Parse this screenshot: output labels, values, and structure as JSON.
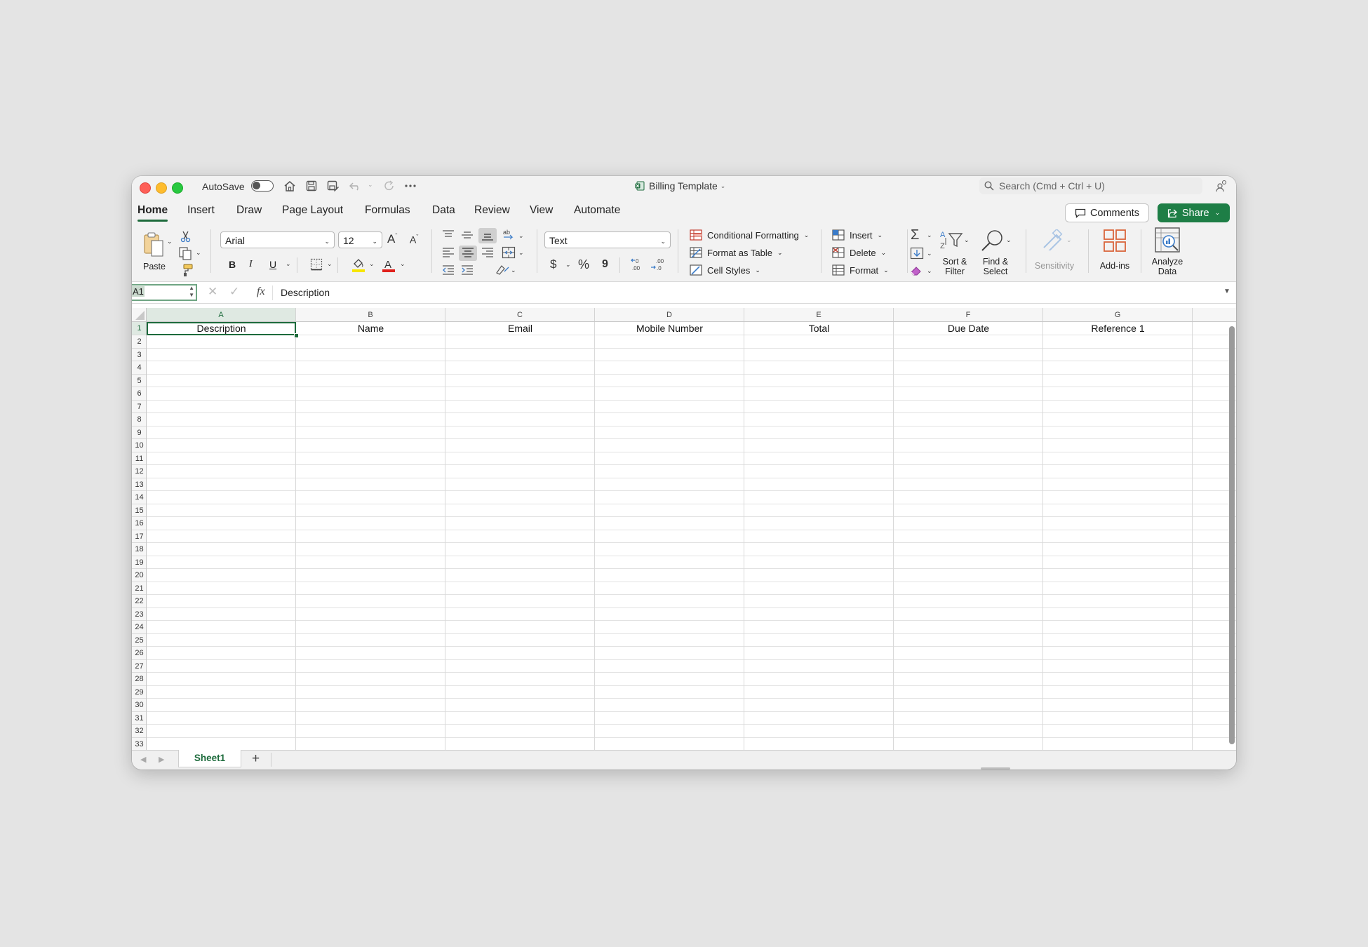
{
  "titlebar": {
    "autosave_label": "AutoSave",
    "doc_title": "Billing Template",
    "search_placeholder": "Search (Cmd + Ctrl + U)"
  },
  "tabs": [
    "Home",
    "Insert",
    "Draw",
    "Page Layout",
    "Formulas",
    "Data",
    "Review",
    "View",
    "Automate"
  ],
  "actions": {
    "comments": "Comments",
    "share": "Share"
  },
  "ribbon": {
    "paste_label": "Paste",
    "font_name": "Arial",
    "font_size": "12",
    "bold": "B",
    "italic": "I",
    "underline": "U",
    "number_format": "Text",
    "currency_symbol": "$",
    "percent_symbol": "%",
    "comma_symbol": "9",
    "conditional_formatting": "Conditional Formatting",
    "format_as_table": "Format as Table",
    "cell_styles": "Cell Styles",
    "insert": "Insert",
    "delete": "Delete",
    "format": "Format",
    "sort_filter": [
      "Sort &",
      "Filter"
    ],
    "find_select": [
      "Find &",
      "Select"
    ],
    "sensitivity": "Sensitivity",
    "addins": "Add-ins",
    "analyze": [
      "Analyze",
      "Data"
    ]
  },
  "formula_bar": {
    "name_box": "A1",
    "fx": "fx",
    "content": "Description"
  },
  "sheet": {
    "columns": [
      "A",
      "B",
      "C",
      "D",
      "E",
      "F",
      "G"
    ],
    "headers": [
      "Description",
      "Name",
      "Email",
      "Mobile Number",
      "Total",
      "Due Date",
      "Reference 1"
    ],
    "rows": [
      "1",
      "2",
      "3",
      "4",
      "5",
      "6",
      "7",
      "8",
      "9",
      "10",
      "11",
      "12",
      "13",
      "14",
      "15",
      "16",
      "17",
      "18",
      "19",
      "20",
      "21",
      "22",
      "23",
      "24",
      "25",
      "26",
      "27",
      "28",
      "29",
      "30",
      "31",
      "32",
      "33"
    ],
    "selected_cell": "A1"
  },
  "sheet_tabs": {
    "active": "Sheet1",
    "add": "+"
  },
  "colors": {
    "accent_green": "#1d6b3c",
    "share_green": "#1e7e46",
    "selection": "#1d6b3c"
  }
}
